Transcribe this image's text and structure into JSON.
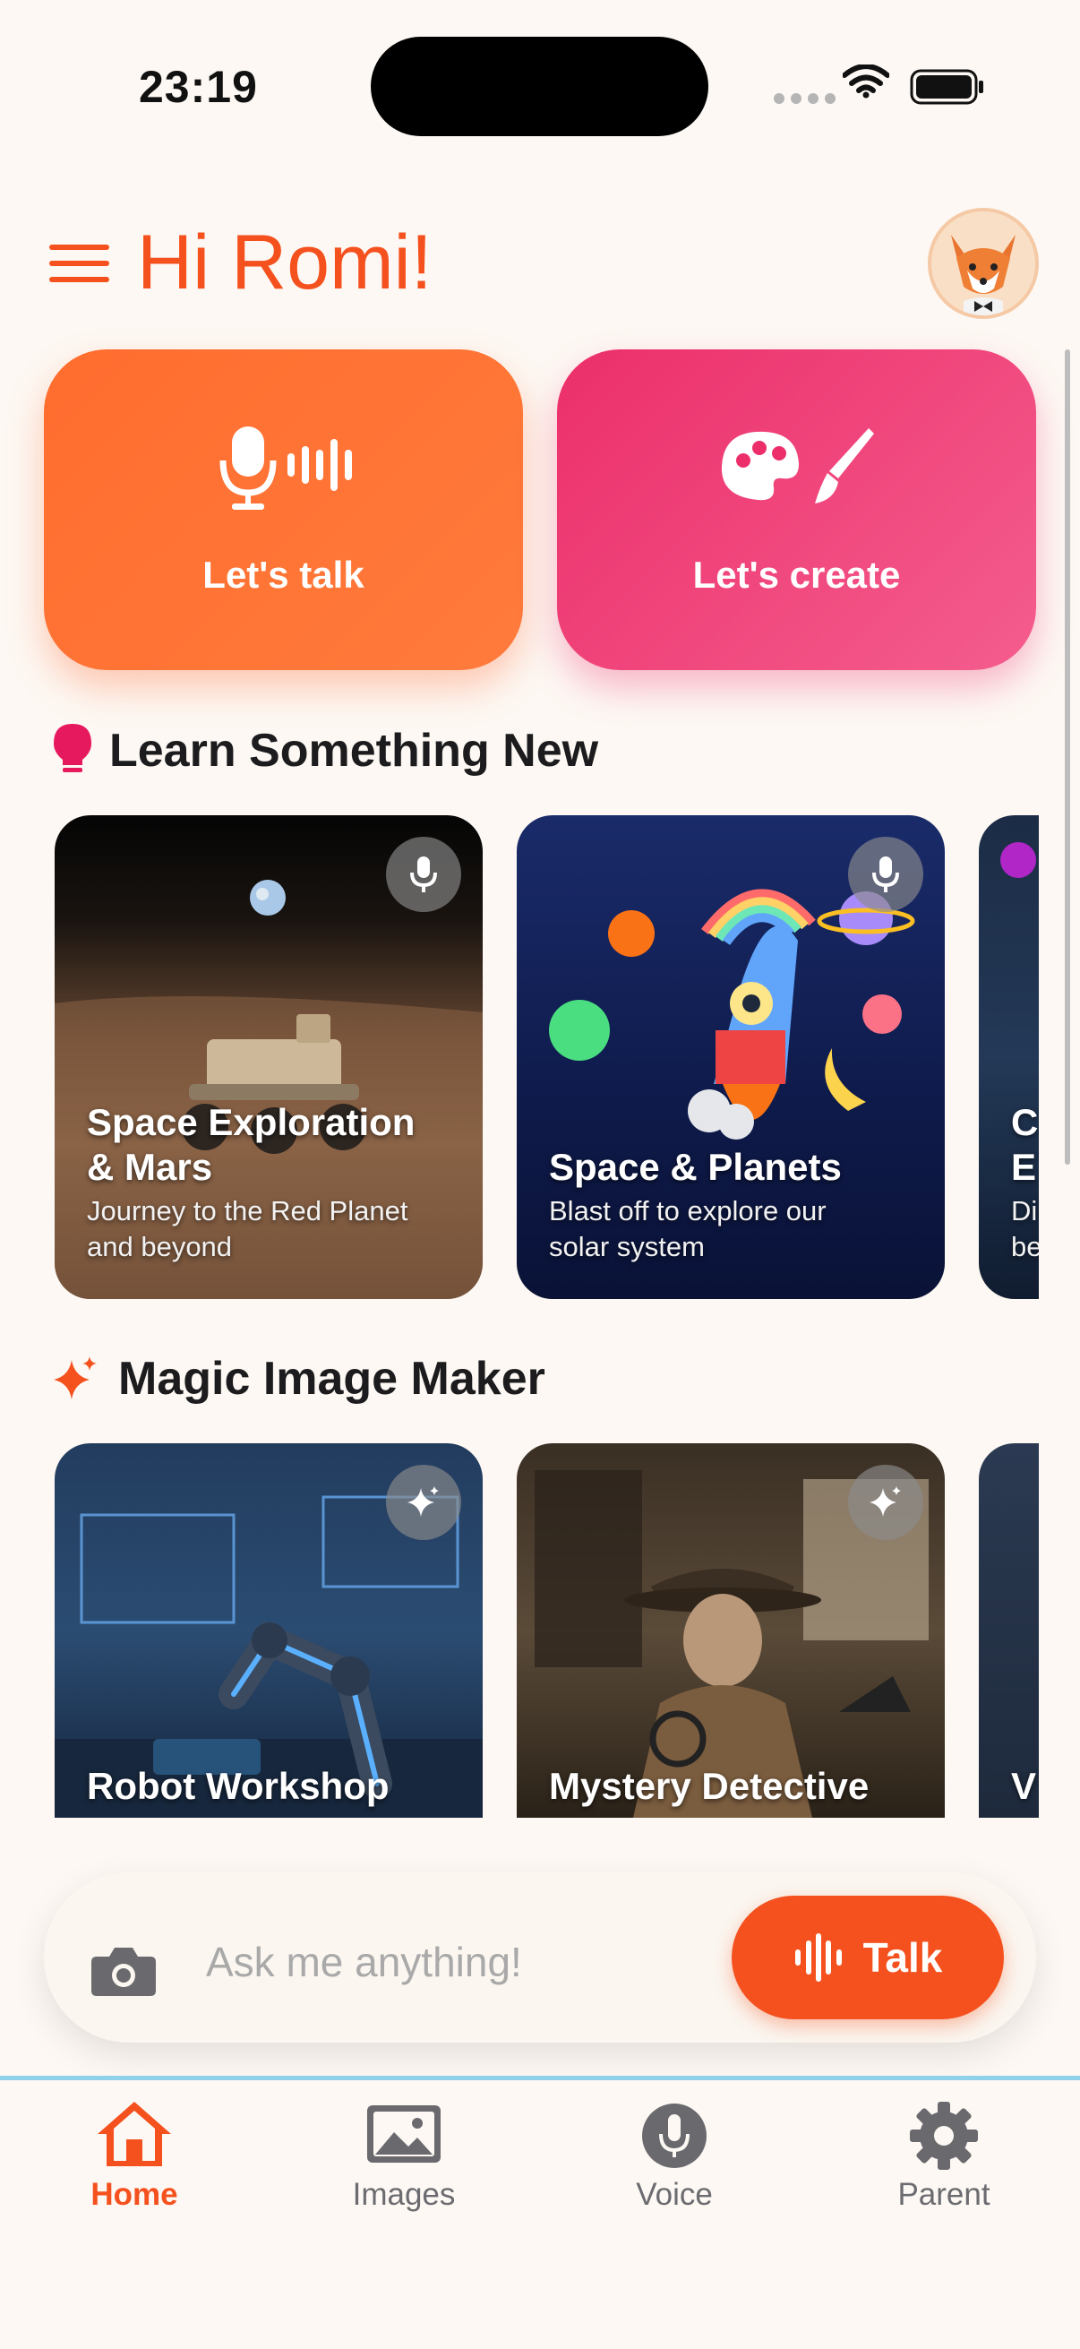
{
  "status_bar": {
    "time": "23:19"
  },
  "header": {
    "greeting": "Hi Romi!"
  },
  "actions": [
    {
      "label": "Let's talk",
      "color": "#ff6d2e"
    },
    {
      "label": "Let's create",
      "color": "#ec2f6b"
    }
  ],
  "learn": {
    "title": "Learn Something New",
    "cards": [
      {
        "title_line1": "Space Exploration",
        "title_line2": "& Mars",
        "sub_line1": "Journey to the Red Planet",
        "sub_line2": "and beyond"
      },
      {
        "title_line1": "Space & Planets",
        "sub_line1": "Blast off to explore our",
        "sub_line2": "solar system"
      },
      {
        "title_line1": "C",
        "title_line2": "E",
        "sub_line1": "Di",
        "sub_line2": "be"
      }
    ]
  },
  "magic": {
    "title": "Magic Image Maker",
    "cards": [
      {
        "title": "Robot Workshop"
      },
      {
        "title": "Mystery Detective"
      },
      {
        "title": "V"
      }
    ]
  },
  "composer": {
    "placeholder": "Ask me anything!",
    "talk_label": "Talk"
  },
  "tabs": [
    {
      "label": "Home",
      "icon": "home-icon",
      "active": true
    },
    {
      "label": "Images",
      "icon": "image-icon",
      "active": false
    },
    {
      "label": "Voice",
      "icon": "mic-icon",
      "active": false
    },
    {
      "label": "Parent",
      "icon": "gear-icon",
      "active": false
    }
  ],
  "colors": {
    "accent": "#f4511e",
    "pink": "#ec2f6b",
    "background": "#fdf8f3"
  }
}
